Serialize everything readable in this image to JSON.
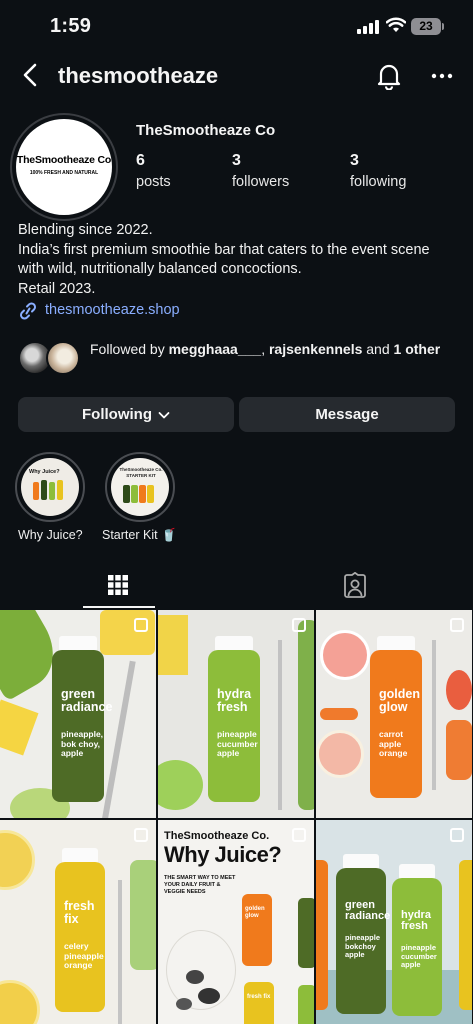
{
  "status_bar": {
    "time": "1:59",
    "battery": "23"
  },
  "header": {
    "handle": "thesmootheaze"
  },
  "profile": {
    "avatar_name": "TheSmootheaze Co",
    "avatar_tagline": "100% FRESH AND NATURAL",
    "display_name": "TheSmootheaze Co",
    "stats": [
      {
        "value": "6",
        "label": "posts"
      },
      {
        "value": "3",
        "label": "followers"
      },
      {
        "value": "3",
        "label": "following"
      }
    ],
    "bio_lines": [
      "Blending since 2022.",
      "India’s first premium smoothie bar that caters to the event scene",
      "with wild, nutritionally balanced concoctions.",
      "Retail 2023."
    ],
    "link": "thesmootheaze.shop",
    "followed_prefix": "Followed by",
    "followed_user_1": "megghaaa___",
    "followed_sep": ",",
    "followed_user_2": "rajsenkennels",
    "followed_and": "and",
    "followed_other": "1 other"
  },
  "actions": {
    "following_label": "Following",
    "message_label": "Message"
  },
  "highlights": [
    {
      "label": "Why Juice?",
      "image_text": "Why Juice?"
    },
    {
      "label": "Starter Kit 🥤",
      "image_text": "TheSmootheaze Co. STARTER KIT"
    }
  ],
  "posts": [
    {
      "title_1": "green",
      "title_2": "radiance",
      "ingredients": "pineapple, bok choy, apple",
      "bottle_color": "#4e6b26"
    },
    {
      "title_1": "hydra",
      "title_2": "fresh",
      "ingredients": "pineapple cucumber apple",
      "bottle_color": "#8dbd3a"
    },
    {
      "title_1": "golden",
      "title_2": "glow",
      "ingredients": "carrot apple orange",
      "bottle_color": "#f07a1c"
    },
    {
      "title_1": "fresh",
      "title_2": "fix",
      "ingredients": "celery pineapple orange",
      "bottle_color": "#e8c31f"
    },
    {
      "brand": "TheSmootheaze Co.",
      "title": "Why Juice?",
      "subtitle_1": "THE SMART WAY TO MEET",
      "subtitle_2": "YOUR DAILY FRUIT &",
      "subtitle_3": "VEGGIE NEEDS",
      "bottle_1": "golden glow",
      "bottle_2": "fresh fix"
    },
    {
      "title_1": "green",
      "title_2": "radiance",
      "ingredients": "pineapple bokchoy apple",
      "title_b1": "hydra",
      "title_b2": "fresh",
      "ingredients_b": "pineapple cucumber apple"
    }
  ]
}
